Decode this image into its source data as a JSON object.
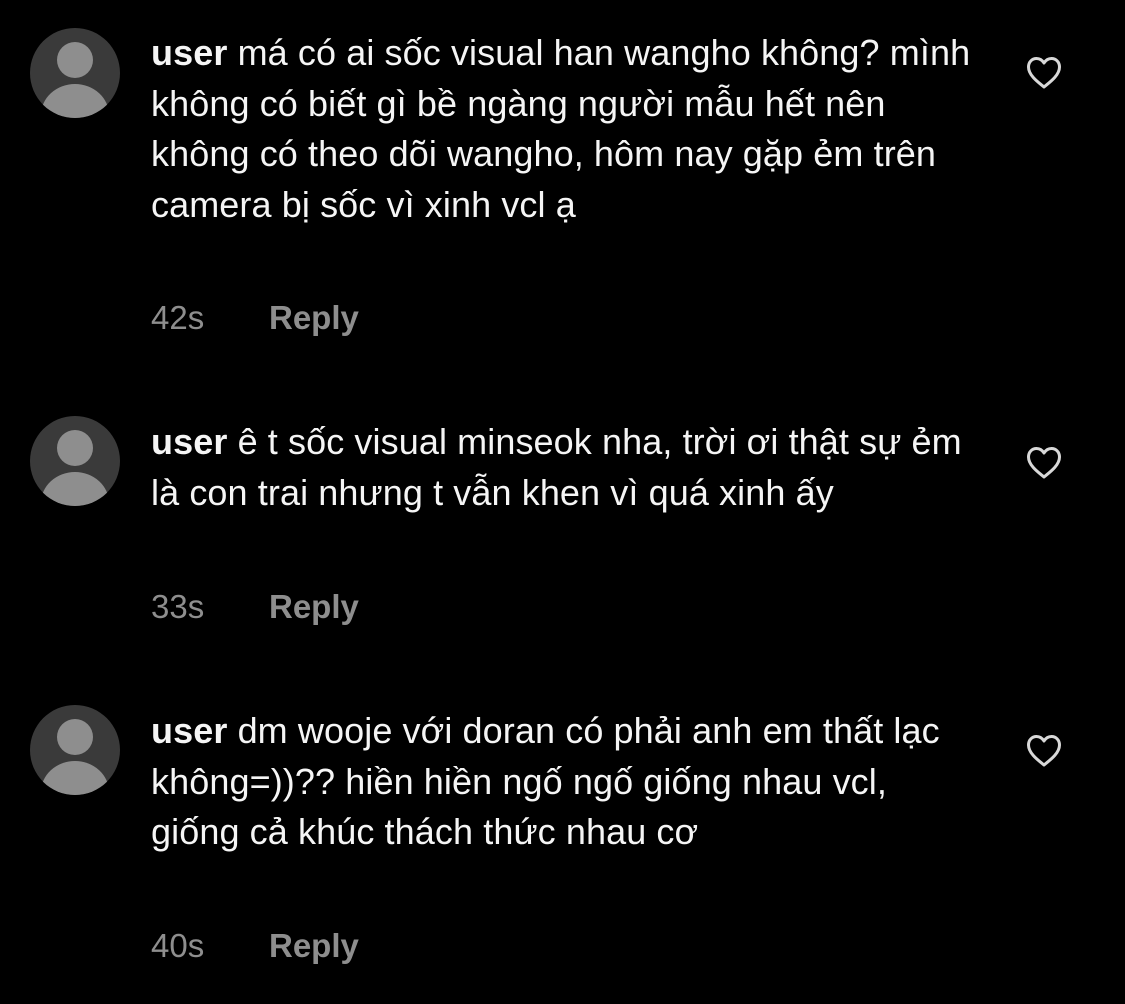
{
  "comments": [
    {
      "username": "user",
      "text": "má có ai sốc visual han wangho không? mình không có biết gì bề ngàng người mẫu hết nên không có theo dõi wangho, hôm nay gặp ẻm trên camera bị sốc vì xinh vcl ạ",
      "time": "42s",
      "reply_label": "Reply",
      "avatar_icon": "default-avatar-icon",
      "like_icon": "heart-outline-icon"
    },
    {
      "username": "user",
      "text": "ê t sốc visual minseok nha, trời ơi thật sự ẻm là con trai nhưng t vẫn khen vì quá xinh ấy",
      "time": "33s",
      "reply_label": "Reply",
      "avatar_icon": "default-avatar-icon",
      "like_icon": "heart-outline-icon"
    },
    {
      "username": "user",
      "text": "dm wooje với doran có phải anh em thất lạc không=))?? hiền hiền ngố ngố giống nhau vcl, giống cả khúc thách thức nhau cơ",
      "time": "40s",
      "reply_label": "Reply",
      "avatar_icon": "default-avatar-icon",
      "like_icon": "heart-outline-icon"
    }
  ],
  "colors": {
    "background": "#000000",
    "primary_text": "#f5f5f5",
    "secondary_text": "#8e8e8e",
    "avatar_bg": "#3a3a3a",
    "avatar_fg": "#8e8e8e",
    "icon": "#d8d8d8"
  }
}
